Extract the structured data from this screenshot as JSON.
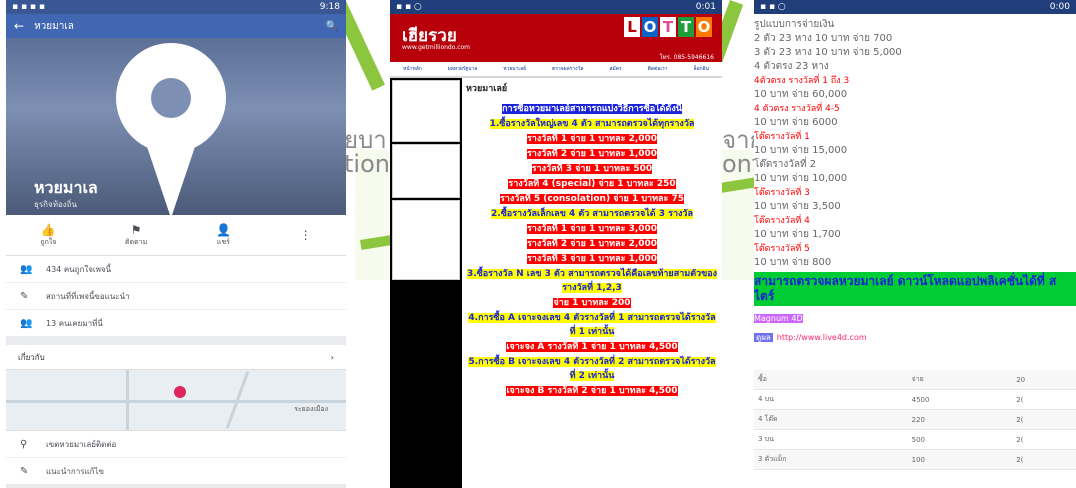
{
  "background": {
    "text_line1": "ยบา",
    "text_line1b": "จาก",
    "text_line2": "tion",
    "text_line2b": "ont",
    "accent_green": "#8cc63f",
    "accent_yellow": "#f7e21a",
    "accent_blue": "#4fb4e6"
  },
  "phone1": {
    "status_time": "9:18",
    "topbar_title": "หวยมาเล",
    "page_name": "หวยมาเล",
    "page_sub": "ธุรกิจท้องถิ่น",
    "actions": [
      {
        "icon": "thumbs-up-icon",
        "label": "ถูกใจ"
      },
      {
        "icon": "flag-icon",
        "label": "ติดตาม"
      },
      {
        "icon": "person-icon",
        "label": "แชร์"
      }
    ],
    "info": [
      {
        "icon": "people-icon",
        "text": "434 คนถูกใจเพจนี้"
      },
      {
        "icon": "pencil-icon",
        "text": "สถานที่ที่เพจนี้ขอแนะนำ"
      },
      {
        "icon": "people-icon",
        "text": "13 คนเคยมาที่นี่"
      }
    ],
    "map_title": "เกี่ยวกับ",
    "map_label": "ระยองเมือง",
    "addr_rows": [
      {
        "icon": "location-icon",
        "text": "เขตหวยมาเลย์ติดต่อ"
      },
      {
        "icon": "pencil-icon",
        "text": "แนะนำการแก้ไข"
      }
    ]
  },
  "phone2": {
    "status_time": "0:01",
    "logo_th": "เฮียรวย",
    "url": "www.getmilliondo.com",
    "phone": "โทร. 085-5946616",
    "lotto": [
      "L",
      "O",
      "T",
      "T",
      "O"
    ],
    "nav": [
      "หน้าหลัก",
      "ผลหวยรัฐบาล",
      "หวยมาเลย์",
      "ตรวจผลรางวัล",
      "สมัคร",
      "ติดต่อเรา",
      "ล็อกอิน"
    ],
    "content_title": "หวยมาเลย์",
    "lines": [
      {
        "style": "blue",
        "text": "การซื้อหวยมาเลย์สามารถแบ่งวิธีการซื้อได้ดังนี้"
      },
      {
        "style": "yellow",
        "text": "1.ซื้อรางวัลใหญ่เลข 4 ตัว สามารถตรวจได้ทุกรางวัล"
      },
      {
        "style": "red",
        "text": "รางวัลที่ 1 จ่าย 1 บาทละ 2,000"
      },
      {
        "style": "red",
        "text": "รางวัลที่ 2 จ่าย 1 บาทละ 1,000"
      },
      {
        "style": "red",
        "text": "รางวัลที่ 3 จ่าย 1 บาทละ 500"
      },
      {
        "style": "red",
        "text": "รางวัลที่ 4 (special) จ่าย 1 บาทละ 250"
      },
      {
        "style": "red",
        "text": "รางวัลที่ 5 (consolation) จ่าย 1 บาทละ 75"
      },
      {
        "style": "yellow",
        "text": "2.ซื้อรางวัลเล็กเลข 4 ตัว สามารถตรวจได้ 3 รางวัล"
      },
      {
        "style": "red",
        "text": "รางวัลที่ 1 จ่าย 1 บาทละ 3,000"
      },
      {
        "style": "red",
        "text": "รางวัลที่ 2 จ่าย 1 บาทละ 2,000"
      },
      {
        "style": "red",
        "text": "รางวัลที่ 3 จ่าย 1 บาทละ 1,000"
      },
      {
        "style": "yellow",
        "text": "3.ซื้อรางวัล N เลข 3 ตัว สามารถตรวจได้คือเลขท้ายสามตัวของรางวัลที่ 1,2,3"
      },
      {
        "style": "red",
        "text": "จ่าย 1 บาทละ 200"
      },
      {
        "style": "yellow",
        "text": "4.การซื้อ A เจาะจงเลข 4 ตัวรางวัลที่ 1 สามารถตรวจได้รางวัลที่ 1 เท่านั้น"
      },
      {
        "style": "red",
        "text": "เจาะจง A รางวัลที่ 1 จ่าย 1 บาทละ 4,500"
      },
      {
        "style": "yellow",
        "text": "5.การซื้อ B เจาะจงเลข 4 ตัวรางวัลที่ 2 สามารถตรวจได้รางวัลที่ 2 เท่านั้น"
      },
      {
        "style": "red",
        "text": "เจาะจง B รางวัลที่ 2 จ่าย 1 บาทละ 4,500"
      }
    ]
  },
  "phone3": {
    "status_time": "0:00",
    "lines": [
      {
        "style": "plain",
        "text": "รูปแบบการจ่ายเงิน"
      },
      {
        "style": "plain",
        "text": "2 ตัว 23 หาง   10 บาท จ่าย 700"
      },
      {
        "style": "plain",
        "text": "3 ตัว 23 หาง   10 บาท จ่าย 5,000"
      },
      {
        "style": "plain",
        "text": "4 ตัวตรง 23 หาง"
      },
      {
        "style": "red",
        "text": "4ตัวตรง รางวัลที่ 1 ถึง 3"
      },
      {
        "style": "plain",
        "text": "10 บาท จ่าย 60,000"
      },
      {
        "style": "red",
        "text": "4 ตัวตรง รางวัลที่ 4-5"
      },
      {
        "style": "plain",
        "text": "10 บาท จ่าย 6000"
      },
      {
        "style": "red",
        "text": "โต๊ดรางวัลที่ 1"
      },
      {
        "style": "plain",
        "text": "10 บาท จ่าย 15,000"
      },
      {
        "style": "plain",
        "text": "โต๊ดรางวัลที่ 2"
      },
      {
        "style": "plain",
        "text": "10 บาท จ่าย 10,000"
      },
      {
        "style": "red",
        "text": "โต๊ดรางวัลที่ 3"
      },
      {
        "style": "plain",
        "text": "10 บาท จ่าย 3,500"
      },
      {
        "style": "red",
        "text": "โต๊ดรางวัลที่ 4"
      },
      {
        "style": "plain",
        "text": "10 บาท จ่าย 1,700"
      },
      {
        "style": "red",
        "text": "โต๊ดรางวัลที่ 5"
      },
      {
        "style": "plain",
        "text": "10 บาท จ่าย 800"
      }
    ],
    "green_text": "สามารถตรวจผลหวยมาเลย์ ดาวน์โหลดแอปพลิเคชั่นได้ที่ สไตร์",
    "magnum": "Magnum 4D",
    "link_tag": "ดูผล",
    "link": "http://www.live4d.com",
    "table": [
      [
        "ซื้อ",
        "จ่าย",
        "20"
      ],
      [
        "4 บน",
        "4500",
        "2("
      ],
      [
        "4 โต๊ด",
        "220",
        "2("
      ],
      [
        "3 บน",
        "500",
        "2("
      ],
      [
        "3 ตัวแม็ก",
        "100",
        "2("
      ]
    ]
  }
}
